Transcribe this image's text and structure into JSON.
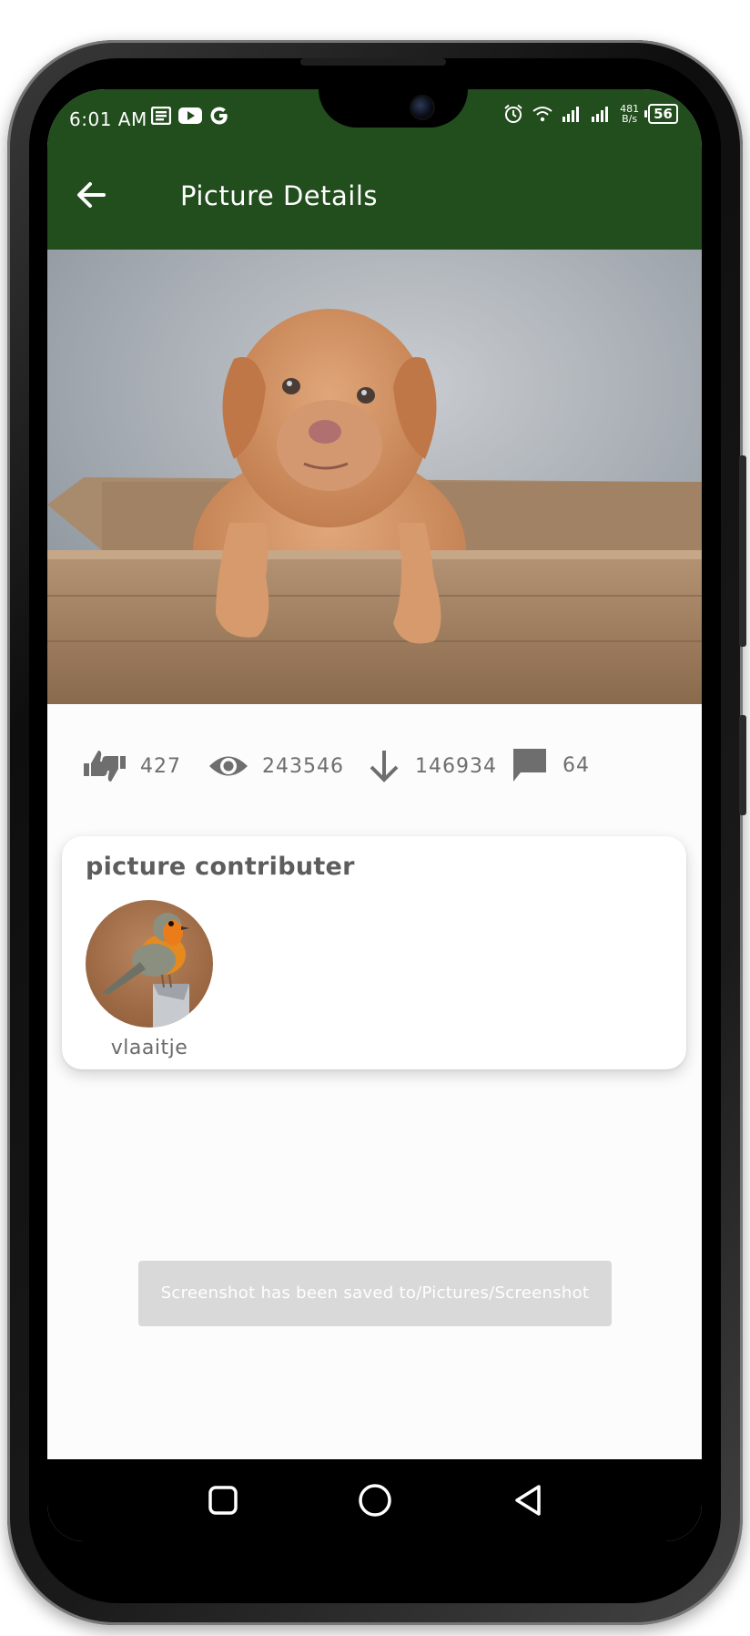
{
  "status_bar": {
    "time": "6:01 AM",
    "net_speed_value": "481",
    "net_speed_unit": "B/s",
    "battery": "56"
  },
  "header": {
    "title": "Picture Details",
    "background": "#224d1d"
  },
  "image": {
    "subject": "puppy-in-wooden-crate-photo"
  },
  "stats": {
    "likes": "427",
    "views": "243546",
    "downloads": "146934",
    "comments": "64"
  },
  "contributor": {
    "section_title": "picture contributer",
    "username": "vlaaitje"
  },
  "toast": {
    "message": "Screenshot has been saved to/Pictures/Screenshot"
  },
  "icons": {
    "back": "arrow-left-icon",
    "likes": "thumbs-up-down-icon",
    "views": "eye-icon",
    "downloads": "arrow-down-icon",
    "comments": "comment-icon",
    "nav_recent": "square-icon",
    "nav_home": "circle-icon",
    "nav_back": "triangle-back-icon"
  }
}
